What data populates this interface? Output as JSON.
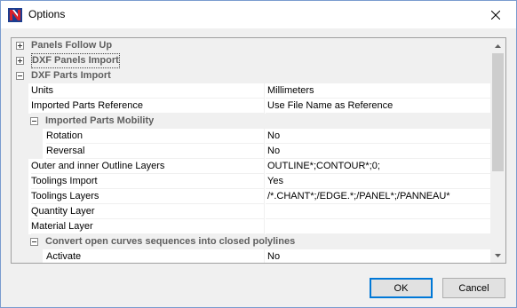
{
  "window": {
    "title": "Options",
    "icon": "app-logo-icon",
    "close_icon": "close-icon"
  },
  "properties": [
    {
      "kind": "category",
      "level": 0,
      "label": "Panels Follow Up",
      "expanded": false
    },
    {
      "kind": "category",
      "level": 0,
      "label": "DXF Panels Import",
      "expanded": false,
      "focused": true
    },
    {
      "kind": "category",
      "level": 0,
      "label": "DXF Parts Import",
      "expanded": true
    },
    {
      "kind": "property",
      "level": 1,
      "label": "Units",
      "value": "Millimeters"
    },
    {
      "kind": "property",
      "level": 1,
      "label": "Imported Parts Reference",
      "value": "Use File Name as Reference"
    },
    {
      "kind": "category",
      "level": 1,
      "label": "Imported Parts Mobility",
      "expanded": true
    },
    {
      "kind": "property",
      "level": 2,
      "label": "Rotation",
      "value": "No"
    },
    {
      "kind": "property",
      "level": 2,
      "label": "Reversal",
      "value": "No"
    },
    {
      "kind": "property",
      "level": 1,
      "label": "Outer and inner Outline Layers",
      "value": "OUTLINE*;CONTOUR*;0;"
    },
    {
      "kind": "property",
      "level": 1,
      "label": "Toolings Import",
      "value": "Yes"
    },
    {
      "kind": "property",
      "level": 1,
      "label": "Toolings Layers",
      "value": "/*.CHANT*;/EDGE.*;/PANEL*;/PANNEAU*"
    },
    {
      "kind": "property",
      "level": 1,
      "label": "Quantity Layer",
      "value": ""
    },
    {
      "kind": "property",
      "level": 1,
      "label": "Material Layer",
      "value": ""
    },
    {
      "kind": "category",
      "level": 1,
      "label": "Convert open curves sequences into closed polylines",
      "expanded": true
    },
    {
      "kind": "property",
      "level": 2,
      "label": "Activate",
      "value": "No"
    }
  ],
  "scrollbar": {
    "position_fraction": 0.0,
    "visible_fraction": 0.6
  },
  "buttons": {
    "ok": "OK",
    "cancel": "Cancel"
  },
  "colors": {
    "category_background": "#f0f0f0",
    "category_text": "#5f5f5f",
    "default_button_border": "#0078d7",
    "app_icon_red": "#d9202b",
    "app_icon_blue": "#1b3d8f"
  }
}
